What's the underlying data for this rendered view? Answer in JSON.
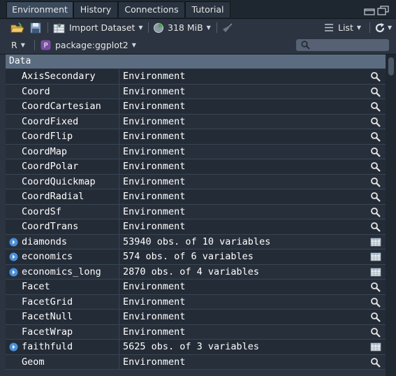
{
  "tabs": [
    "Environment",
    "History",
    "Connections",
    "Tutorial"
  ],
  "toolbar": {
    "import_label": "Import Dataset",
    "memory_label": "318 MiB",
    "view_mode": "List"
  },
  "envbar": {
    "language": "R",
    "scope": "package:ggplot2",
    "search_placeholder": ""
  },
  "grid": {
    "section": "Data",
    "rows": [
      {
        "name": "AxisSecondary",
        "value": "Environment",
        "kind": "env"
      },
      {
        "name": "Coord",
        "value": "Environment",
        "kind": "env"
      },
      {
        "name": "CoordCartesian",
        "value": "Environment",
        "kind": "env"
      },
      {
        "name": "CoordFixed",
        "value": "Environment",
        "kind": "env"
      },
      {
        "name": "CoordFlip",
        "value": "Environment",
        "kind": "env"
      },
      {
        "name": "CoordMap",
        "value": "Environment",
        "kind": "env"
      },
      {
        "name": "CoordPolar",
        "value": "Environment",
        "kind": "env"
      },
      {
        "name": "CoordQuickmap",
        "value": "Environment",
        "kind": "env"
      },
      {
        "name": "CoordRadial",
        "value": "Environment",
        "kind": "env"
      },
      {
        "name": "CoordSf",
        "value": "Environment",
        "kind": "env"
      },
      {
        "name": "CoordTrans",
        "value": "Environment",
        "kind": "env"
      },
      {
        "name": "diamonds",
        "value": "53940 obs. of 10 variables",
        "kind": "data"
      },
      {
        "name": "economics",
        "value": "574 obs. of 6 variables",
        "kind": "data"
      },
      {
        "name": "economics_long",
        "value": "2870 obs. of 4 variables",
        "kind": "data"
      },
      {
        "name": "Facet",
        "value": "Environment",
        "kind": "env"
      },
      {
        "name": "FacetGrid",
        "value": "Environment",
        "kind": "env"
      },
      {
        "name": "FacetNull",
        "value": "Environment",
        "kind": "env"
      },
      {
        "name": "FacetWrap",
        "value": "Environment",
        "kind": "env"
      },
      {
        "name": "faithfuld",
        "value": "5625 obs. of 3 variables",
        "kind": "data"
      },
      {
        "name": "Geom",
        "value": "Environment",
        "kind": "env"
      }
    ]
  },
  "icons": {
    "open": "folder-open-icon",
    "save": "save-icon",
    "import": "import-dataset-icon",
    "memory": "memory-pie-icon",
    "broom": "broom-icon",
    "list": "list-icon",
    "refresh": "refresh-icon",
    "r_pkg": "package-icon",
    "search": "search-icon",
    "view": "magnifier-icon",
    "table": "table-icon",
    "expand": "expand-arrow-icon"
  },
  "colors": {
    "accent": "#4a90d9",
    "package_badge": "#7b4fa3",
    "header": "#5c6c80"
  }
}
